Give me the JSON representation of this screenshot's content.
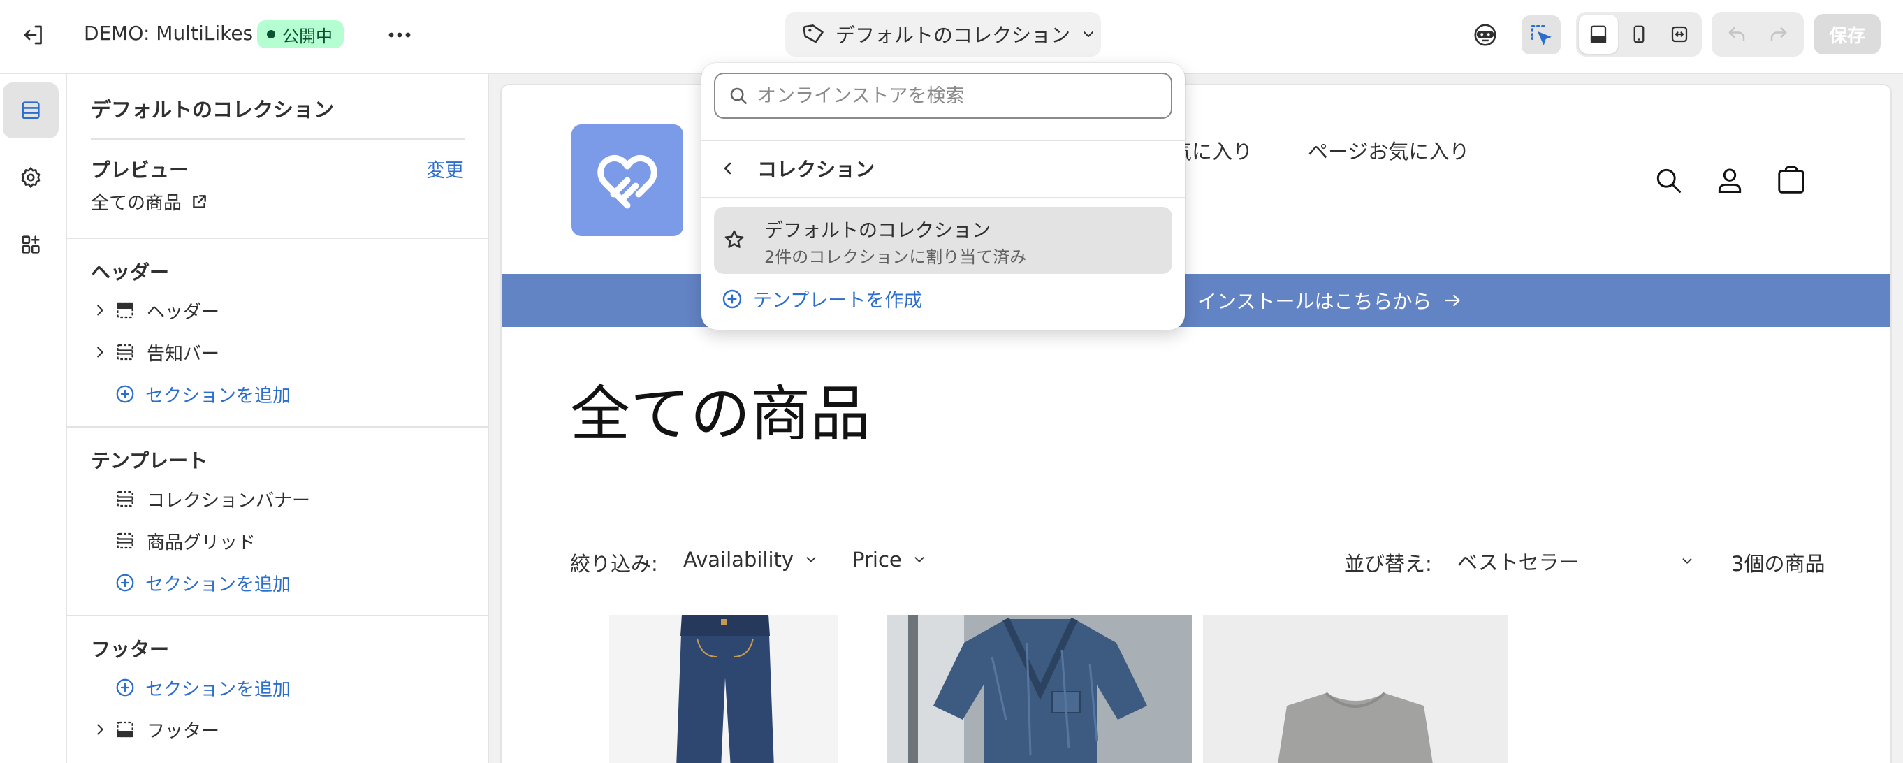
{
  "topbar": {
    "store_name": "DEMO: MultiLikes",
    "status": "公開中",
    "template_selector": "デフォルトのコレクション",
    "save": "保存"
  },
  "panel": {
    "title": "デフォルトのコレクション",
    "preview_heading": "プレビュー",
    "change_link": "変更",
    "preview_target": "全ての商品",
    "header_group": {
      "heading": "ヘッダー",
      "items": [
        "ヘッダー",
        "告知バー"
      ],
      "add_section": "セクションを追加"
    },
    "template_group": {
      "heading": "テンプレート",
      "items": [
        "コレクションバナー",
        "商品グリッド"
      ],
      "add_section": "セクションを追加"
    },
    "footer_group": {
      "heading": "フッター",
      "add_section": "セクションを追加",
      "items": [
        "フッター"
      ]
    }
  },
  "popover": {
    "search_placeholder": "オンラインストアを検索",
    "back_label": "コレクション",
    "item_title": "デフォルトのコレクション",
    "item_subtitle": "2件のコレクションに割り当て済み",
    "create_template": "テンプレートを作成"
  },
  "storefront": {
    "nav_links": [
      "お気に入り",
      "ページお気に入り"
    ],
    "announcement": "インストールはこちらから",
    "collection_title": "全ての商品",
    "filter_label": "絞り込み:",
    "filter_availability": "Availability",
    "filter_price": "Price",
    "sort_label": "並び替え:",
    "sort_value": "ベストセラー",
    "product_count": "3個の商品"
  },
  "colors": {
    "accent_blue": "#2c6ecb",
    "status_green_bg": "#b4fed2",
    "announcement_bar": "#6283c4",
    "logo_bg": "#7b9ae8"
  }
}
